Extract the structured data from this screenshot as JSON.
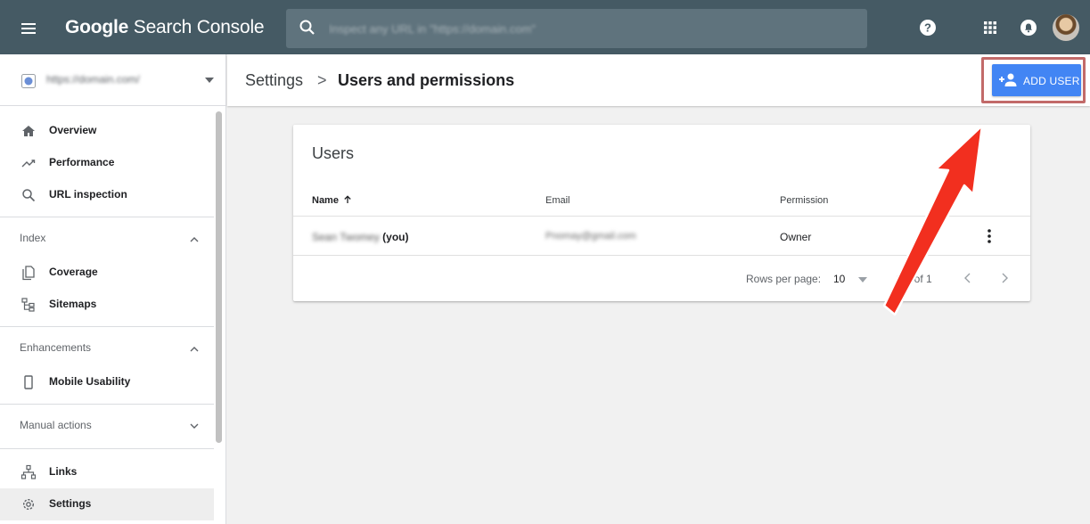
{
  "app": {
    "title_bold": "Google",
    "title_rest": " Search Console"
  },
  "search": {
    "placeholder": "Inspect any URL in \"https://domain.com\""
  },
  "property": {
    "url": "https://domain.com/"
  },
  "sidebar": {
    "items": [
      {
        "label": "Overview",
        "icon": "home-icon"
      },
      {
        "label": "Performance",
        "icon": "trending-up-icon"
      },
      {
        "label": "URL inspection",
        "icon": "search-icon"
      }
    ],
    "index_section": {
      "label": "Index",
      "expanded": true
    },
    "index_items": [
      {
        "label": "Coverage",
        "icon": "copy-icon"
      },
      {
        "label": "Sitemaps",
        "icon": "sitemap-icon"
      }
    ],
    "enhancements_section": {
      "label": "Enhancements",
      "expanded": true
    },
    "enhancements_items": [
      {
        "label": "Mobile Usability",
        "icon": "smartphone-icon"
      }
    ],
    "manual_actions_section": {
      "label": "Manual actions",
      "expanded": false
    },
    "bottom_items": [
      {
        "label": "Links",
        "icon": "links-icon"
      },
      {
        "label": "Settings",
        "icon": "settings-icon",
        "active": true
      }
    ]
  },
  "breadcrumb": {
    "parent": "Settings",
    "separator": ">",
    "current": "Users and permissions"
  },
  "add_user": {
    "label": "ADD USER",
    "color": "#4285f4"
  },
  "users": {
    "title": "Users",
    "columns": {
      "name": "Name",
      "email": "Email",
      "permission": "Permission"
    },
    "sort": "ascending",
    "rows": [
      {
        "name": "Sean Twomey",
        "you": "(you)",
        "email": "Pnomay@gmail.com",
        "permission": "Owner"
      }
    ],
    "pagination": {
      "rows_per_page_label": "Rows per page:",
      "rows_per_page": "10",
      "range": "1-1 of 1"
    }
  },
  "colors": {
    "topbar": "#455a64",
    "accent": "#4285f4",
    "annotation_arrow": "#f22f1f",
    "annotation_box": "#c26a69"
  }
}
